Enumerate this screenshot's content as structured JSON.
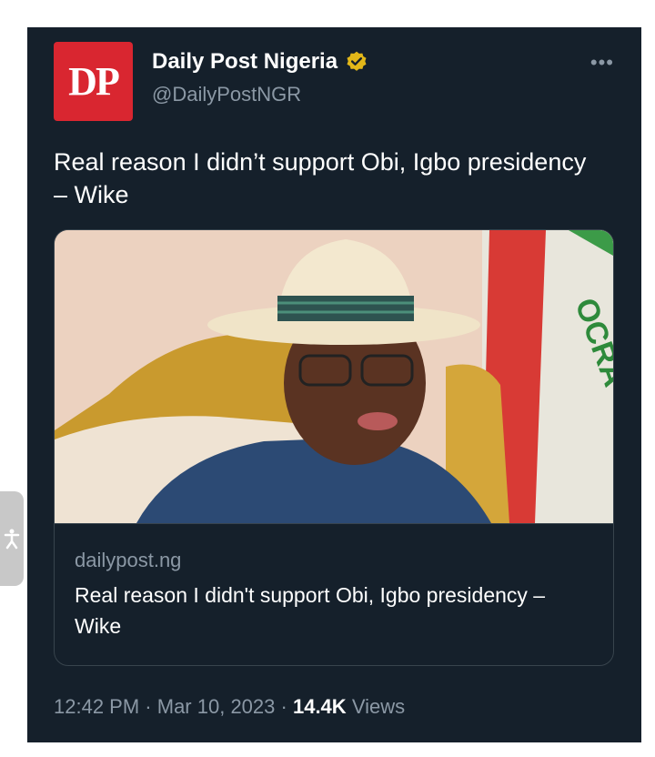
{
  "account": {
    "avatar_text": "DP",
    "name": "Daily Post Nigeria",
    "handle": "@DailyPostNGR",
    "verified_icon": "verified-badge-gold",
    "more_label": "•••"
  },
  "tweet": {
    "text": "Real reason I didn’t support Obi, Igbo presidency – Wike"
  },
  "card": {
    "image_alt": "Man in white hat and glasses seated on gold chair",
    "image_text": "OCRA",
    "domain": "dailypost.ng",
    "title": "Real reason I didn't support Obi, Igbo presidency – Wike"
  },
  "meta": {
    "time": "12:42 PM",
    "separator": "·",
    "date": "Mar 10, 2023",
    "views_count": "14.4K",
    "views_label": "Views"
  },
  "colors": {
    "background": "#15202b",
    "secondary_text": "#8b98a5",
    "brand_red": "#d92630",
    "verified_gold": "#e2b719"
  },
  "accessibility": {
    "icon": "accessibility-icon"
  }
}
